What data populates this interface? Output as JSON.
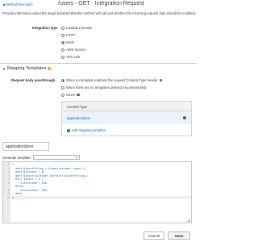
{
  "header": {
    "back_link": "Method Execution",
    "title": "/users - GET - Integration Request"
  },
  "description": "Provide information about the target backend that this method will call and whether the incoming request data should be modified.",
  "integration": {
    "label": "Integration type",
    "options": [
      "Lambda Function",
      "HTTP",
      "Mock",
      "AWS Service",
      "VPC Link"
    ],
    "selected": "Mock"
  },
  "mapping": {
    "section_title": "Mapping Templates",
    "passthrough_label": "Request body passthrough",
    "passthrough_options": [
      "When no template matches the request Content-Type header",
      "When there are no templates defined (recommended)",
      "Never"
    ],
    "passthrough_selected": "When no template matches the request Content-Type header",
    "table_header": "Content-Type",
    "rows": [
      "application/json"
    ],
    "add_label": "Add mapping template"
  },
  "template": {
    "content_type": "application/json",
    "generate_label": "Generate template:",
    "code_lines": [
      "{",
      "  #set($countString = $input.params('count'))",
      "  #set($Integer = 0)",
      "  #set($count=$Integer.parseInt($countString))",
      "  #if( $count > 0 )",
      "    \"statusCode\": 200",
      "  #else",
      "    \"statusCode\": 500",
      "  #end",
      "}"
    ]
  },
  "buttons": {
    "cancel": "Cancel",
    "save": "Save"
  },
  "colors": {
    "link": "#1a67b5",
    "selected_row": "#eaf2fa",
    "warning": "#f0a030"
  }
}
